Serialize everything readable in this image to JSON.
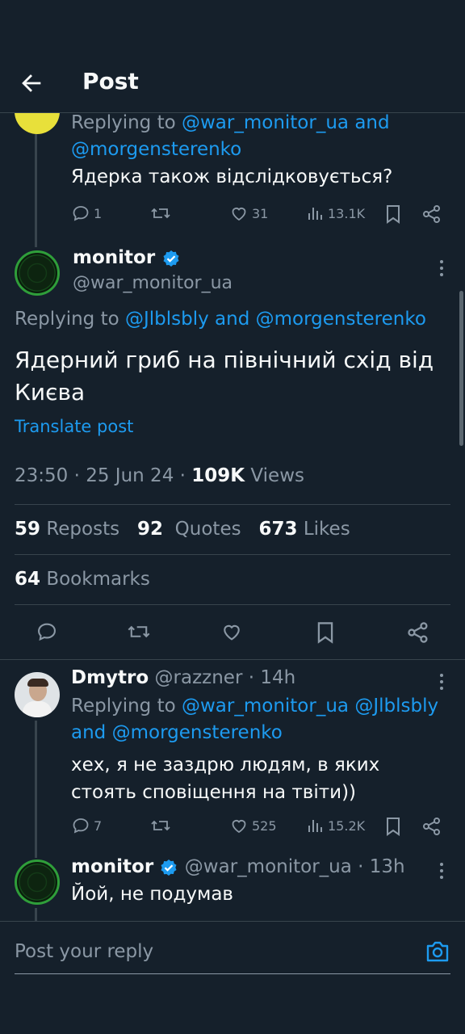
{
  "header": {
    "title": "Post"
  },
  "parent_reply": {
    "replying_prefix": "Replying to ",
    "replying_to_1": "@war_monitor_ua",
    "replying_and": " and",
    "replying_to_2": "@morgensterenko",
    "text": "Ядерка також відслідковується?",
    "replies": "1",
    "likes": "31",
    "views": "13.1K"
  },
  "main_post": {
    "name": "monitor",
    "handle": "@war_monitor_ua",
    "replying_prefix": "Replying to ",
    "replying_to_1": "@Jlblsbly",
    "replying_and": " and ",
    "replying_to_2": "@morgensterenko",
    "text": "Ядерний гриб на північний схід від Києва",
    "translate": "Translate post",
    "time": "23:50",
    "date": "25 Jun 24",
    "views_count": "109K",
    "views_label": "Views",
    "reposts_count": "59",
    "reposts_label": "Reposts",
    "quotes_count": "92",
    "quotes_label": "Quotes",
    "likes_count": "673",
    "likes_label": "Likes",
    "bookmarks_count": "64",
    "bookmarks_label": "Bookmarks"
  },
  "reply_1": {
    "name": "Dmytro",
    "handle": "@razzner",
    "time": "14h",
    "replying_prefix": "Replying to ",
    "replying_to_1": "@war_monitor_ua",
    "replying_to_2": "@Jlblsbly",
    "replying_and": "and ",
    "replying_to_3": "@morgensterenko",
    "text": "хех, я не заздрю людям, в яких стоять сповіщення на твіти))",
    "replies": "7",
    "likes": "525",
    "views": "15.2K"
  },
  "reply_2": {
    "name": "monitor",
    "handle": "@war_monitor_ua",
    "time": "13h",
    "text": "Йой, не подумав"
  },
  "composer": {
    "placeholder": "Post your reply"
  },
  "colors": {
    "accent": "#1d9bf0",
    "background": "#15202b",
    "muted": "#8b98a5"
  }
}
